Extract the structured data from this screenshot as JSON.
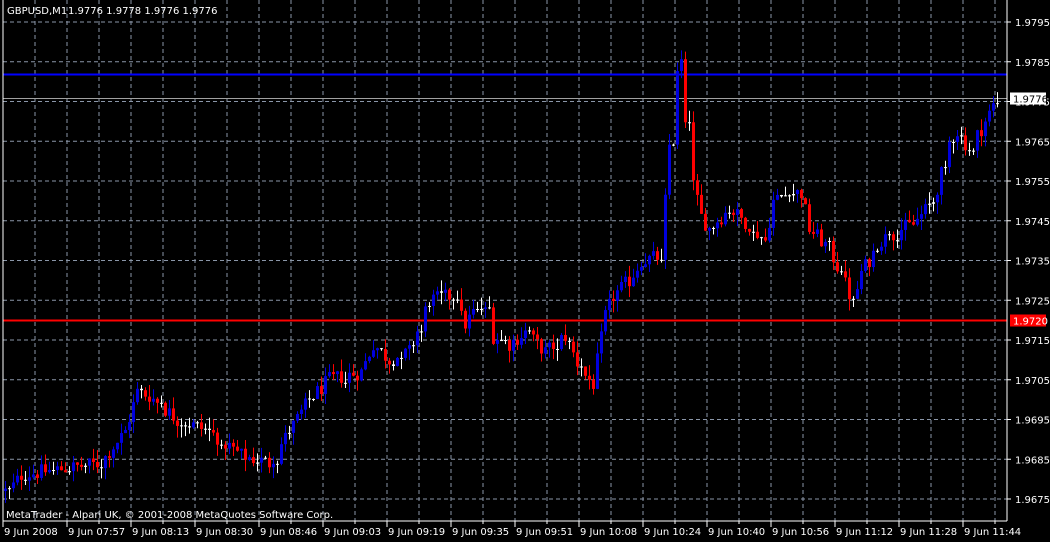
{
  "chart_data": {
    "type": "candlestick",
    "symbol": "GBPUSD,M1",
    "header_ohlc": "1.9776 1.9778 1.9776 1.9776",
    "copyright": "MetaTrader - Alpari UK, © 2001-2008 MetaQuotes Software Corp.",
    "ylim": [
      1.9668,
      1.98
    ],
    "y_ticks": [
      "1.9795",
      "1.9785",
      "1.9775",
      "1.9765",
      "1.9755",
      "1.9745",
      "1.9735",
      "1.9725",
      "1.9715",
      "1.9705",
      "1.9695",
      "1.9685",
      "1.9675"
    ],
    "x_ticks": [
      "9 Jun 2008",
      "9 Jun 07:57",
      "9 Jun 08:13",
      "9 Jun 08:30",
      "9 Jun 08:46",
      "9 Jun 09:03",
      "9 Jun 09:19",
      "9 Jun 09:35",
      "9 Jun 09:51",
      "9 Jun 10:08",
      "9 Jun 10:24",
      "9 Jun 10:40",
      "9 Jun 10:56",
      "9 Jun 11:12",
      "9 Jun 11:28",
      "9 Jun 11:44"
    ],
    "bar_count": 249,
    "bars_per_x_tick": 16,
    "close_keypoints": [
      [
        1,
        1.9677
      ],
      [
        4,
        1.9681
      ],
      [
        10,
        1.9682
      ],
      [
        24,
        1.9684
      ],
      [
        26,
        1.9687
      ],
      [
        30,
        1.9692
      ],
      [
        33,
        1.9702
      ],
      [
        36,
        1.9701
      ],
      [
        43,
        1.9695
      ],
      [
        51,
        1.9692
      ],
      [
        59,
        1.9686
      ],
      [
        66,
        1.9684
      ],
      [
        71,
        1.9692
      ],
      [
        76,
        1.97
      ],
      [
        81,
        1.9705
      ],
      [
        89,
        1.9707
      ],
      [
        92,
        1.9714
      ],
      [
        96,
        1.971
      ],
      [
        101,
        1.9712
      ],
      [
        106,
        1.9725
      ],
      [
        111,
        1.9726
      ],
      [
        115,
        1.9719
      ],
      [
        119,
        1.9725
      ],
      [
        122,
        1.9716
      ],
      [
        126,
        1.9714
      ],
      [
        130,
        1.9717
      ],
      [
        135,
        1.9712
      ],
      [
        140,
        1.9716
      ],
      [
        144,
        1.9707
      ],
      [
        147,
        1.9704
      ],
      [
        150,
        1.9721
      ],
      [
        152,
        1.9726
      ],
      [
        156,
        1.973
      ],
      [
        159,
        1.9735
      ],
      [
        164,
        1.9736
      ],
      [
        165,
        1.975
      ],
      [
        167,
        1.9778
      ],
      [
        169,
        1.9785
      ],
      [
        170,
        1.9768
      ],
      [
        171,
        1.9758
      ],
      [
        174,
        1.9746
      ],
      [
        176,
        1.9743
      ],
      [
        181,
        1.9748
      ],
      [
        186,
        1.9744
      ],
      [
        190,
        1.974
      ],
      [
        192,
        1.975
      ],
      [
        196,
        1.9752
      ],
      [
        199,
        1.9752
      ],
      [
        201,
        1.9743
      ],
      [
        206,
        1.9738
      ],
      [
        210,
        1.9729
      ],
      [
        212,
        1.9724
      ],
      [
        214,
        1.9732
      ],
      [
        219,
        1.974
      ],
      [
        224,
        1.9743
      ],
      [
        227,
        1.9744
      ],
      [
        232,
        1.975
      ],
      [
        235,
        1.976
      ],
      [
        237,
        1.9769
      ],
      [
        241,
        1.9763
      ],
      [
        245,
        1.977
      ],
      [
        248,
        1.9776
      ]
    ],
    "hlines": [
      {
        "name": "resistance",
        "price": 1.9782,
        "color": "#0000ff"
      },
      {
        "name": "support",
        "price": 1.972,
        "color": "#ff0000",
        "label": "1.9720"
      },
      {
        "name": "bid",
        "price": 1.9776,
        "color": "#a0a0a0",
        "label": "1.9776"
      }
    ],
    "colors": {
      "bull": "#0000dd",
      "bear": "#ff0000",
      "doji": "#ffffff",
      "grid": "#8a96a8",
      "background": "#000000",
      "axis": "#ffffff"
    }
  }
}
